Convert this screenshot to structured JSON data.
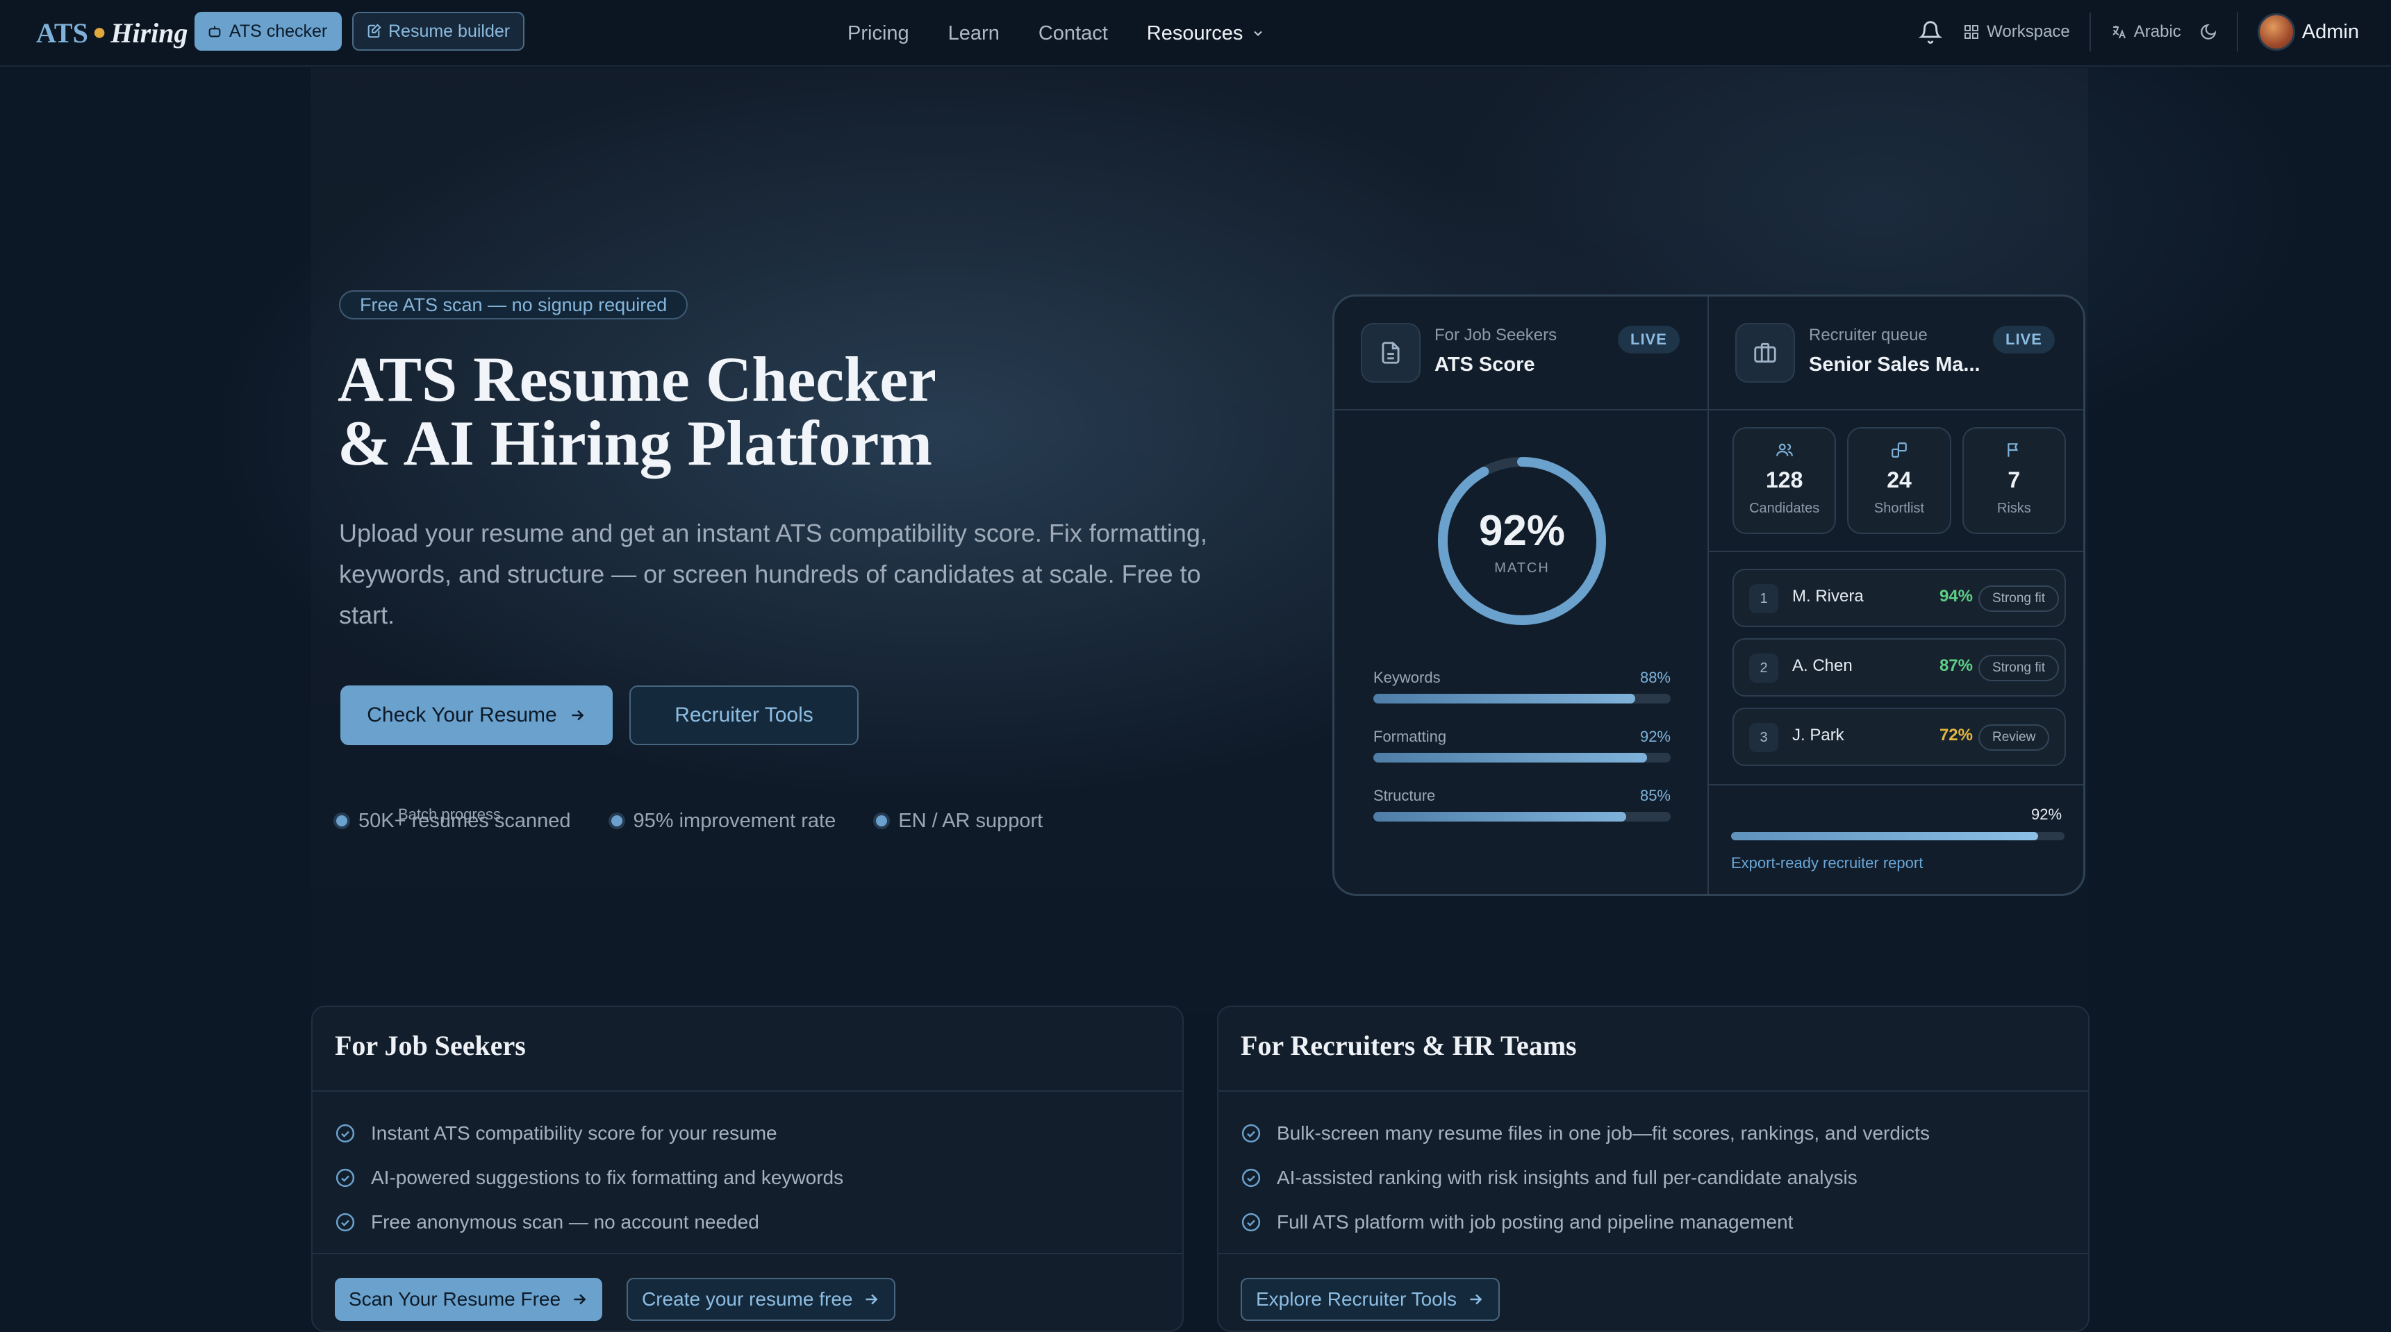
{
  "nav": {
    "logo_ats": "ATS",
    "logo_hiring": "Hiring",
    "ats_checker": "ATS checker",
    "resume_builder": "Resume builder",
    "links": {
      "pricing": "Pricing",
      "learn": "Learn",
      "contact": "Contact",
      "resources": "Resources"
    },
    "workspace": "Workspace",
    "language": "Arabic",
    "user": "Admin"
  },
  "hero": {
    "badge": "Free ATS scan — no signup required",
    "title_line1": "ATS Resume Checker",
    "title_line2": "& AI Hiring Platform",
    "subtitle": "Upload your resume and get an instant ATS compatibility score. Fix formatting, keywords, and structure — or screen hundreds of candidates at scale. Free to start.",
    "cta_primary": "Check Your Resume",
    "cta_secondary": "Recruiter Tools",
    "stats": [
      "50K+ resumes scanned",
      "95% improvement rate",
      "EN / AR support"
    ]
  },
  "dashboard": {
    "seeker": {
      "label": "For Job Seekers",
      "title": "ATS Score",
      "live": "LIVE",
      "score": "92%",
      "score_value": 92,
      "score_caption": "MATCH",
      "metrics": [
        {
          "name": "Keywords",
          "value": "88%",
          "level": 88
        },
        {
          "name": "Formatting",
          "value": "92%",
          "level": 92
        },
        {
          "name": "Structure",
          "value": "85%",
          "level": 85
        }
      ]
    },
    "recruiter": {
      "label": "Recruiter queue",
      "title": "Senior Sales Ma...",
      "live": "LIVE",
      "tiles": [
        {
          "icon": "users-icon",
          "value": "128",
          "label": "Candidates"
        },
        {
          "icon": "shortlist-icon",
          "value": "24",
          "label": "Shortlist"
        },
        {
          "icon": "flag-icon",
          "value": "7",
          "label": "Risks"
        }
      ],
      "candidates": [
        {
          "rank": "1",
          "name": "M. Rivera",
          "score": "94%",
          "verdict": "Strong fit",
          "color": "#5fcf85"
        },
        {
          "rank": "2",
          "name": "A. Chen",
          "score": "87%",
          "verdict": "Strong fit",
          "color": "#5fcf85"
        },
        {
          "rank": "3",
          "name": "J. Park",
          "score": "72%",
          "verdict": "Review",
          "color": "#e4b63f"
        }
      ],
      "batch_label": "Batch progress",
      "batch_value": "92%",
      "batch_level": 92,
      "report_link": "Export-ready recruiter report"
    }
  },
  "features": {
    "seekers": {
      "title": "For Job Seekers",
      "items": [
        "Instant ATS compatibility score for your resume",
        "AI-powered suggestions to fix formatting and keywords",
        "Free anonymous scan — no account needed"
      ],
      "btn_primary": "Scan Your Resume Free",
      "btn_secondary": "Create your resume free"
    },
    "recruiters": {
      "title": "For Recruiters & HR Teams",
      "items": [
        "Bulk-screen many resume files in one job—fit scores, rankings, and verdicts",
        "AI-assisted ranking with risk insights and full per-candidate analysis",
        "Full ATS platform with job posting and pipeline management"
      ],
      "btn_primary": "Explore Recruiter Tools"
    }
  },
  "colors": {
    "accent": "#6aa1cd",
    "background": "#0d1826",
    "success": "#5fcf85",
    "warning": "#e4b63f"
  }
}
